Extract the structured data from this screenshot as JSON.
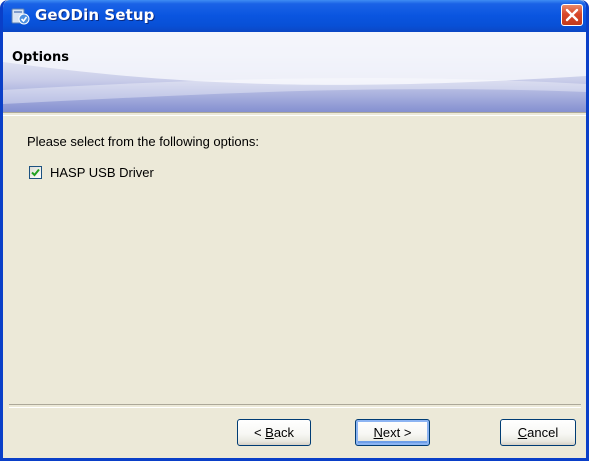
{
  "window": {
    "title": "GeODin Setup",
    "close_icon": "close-icon",
    "app_icon": "setup-app-icon"
  },
  "header": {
    "title": "Options"
  },
  "content": {
    "instruction": "Please select from the following options:",
    "options": [
      {
        "label": "HASP USB Driver",
        "checked": true
      }
    ]
  },
  "buttons": {
    "back": {
      "prefix": "< ",
      "mnemonic": "B",
      "rest": "ack"
    },
    "next": {
      "prefix": "",
      "mnemonic": "N",
      "rest": "ext >"
    },
    "cancel": {
      "prefix": "",
      "mnemonic": "C",
      "rest": "ancel"
    }
  },
  "colors": {
    "titlebar": "#0a55e0",
    "dialog_bg": "#ece9d8",
    "close_button": "#d9482a",
    "checkbox_border": "#1c5180",
    "check_mark": "#21a121"
  }
}
